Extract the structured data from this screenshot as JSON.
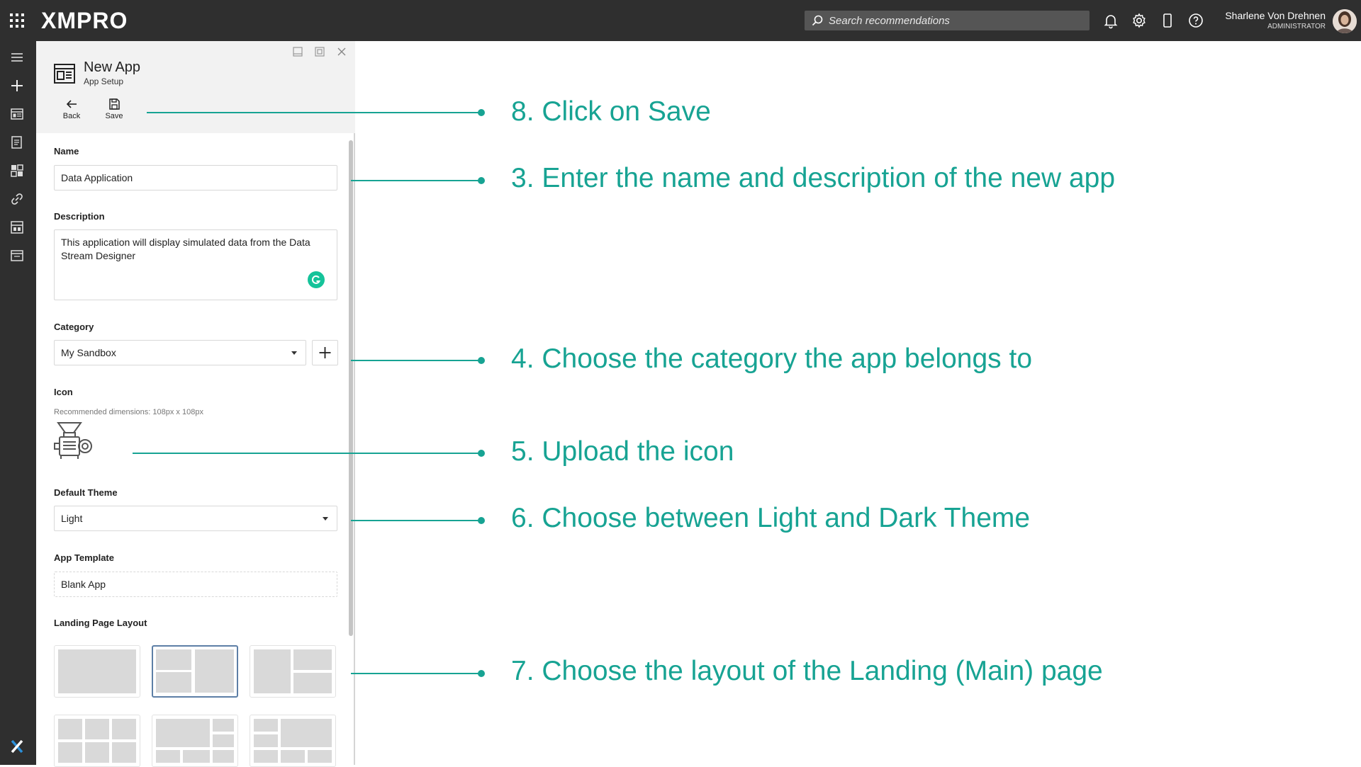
{
  "topbar": {
    "logo": "XMPRO",
    "search_placeholder": "Search recommendations",
    "user_name": "Sharlene Von Drehnen",
    "user_role": "ADMINISTRATOR"
  },
  "panel": {
    "title": "New App",
    "subtitle": "App Setup",
    "back_label": "Back",
    "save_label": "Save",
    "name_label": "Name",
    "name_value": "Data Application",
    "description_label": "Description",
    "description_value": "This application will display simulated data from the Data Stream Designer",
    "category_label": "Category",
    "category_value": "My Sandbox",
    "icon_label": "Icon",
    "icon_hint": "Recommended dimensions: 108px x 108px",
    "theme_label": "Default Theme",
    "theme_value": "Light",
    "template_label": "App Template",
    "template_value": "Blank App",
    "layout_label": "Landing Page Layout"
  },
  "annotations": {
    "save": "8. Click on Save",
    "name": "3. Enter the name and description of the new app",
    "category": "4. Choose the category the app belongs to",
    "icon": "5. Upload the icon",
    "theme": "6. Choose between Light and Dark Theme",
    "layout": "7. Choose the layout of the Landing (Main) page"
  },
  "colors": {
    "accent": "#17a393",
    "topbar": "#2f2f2f",
    "selected_border": "#5d7fa6"
  }
}
